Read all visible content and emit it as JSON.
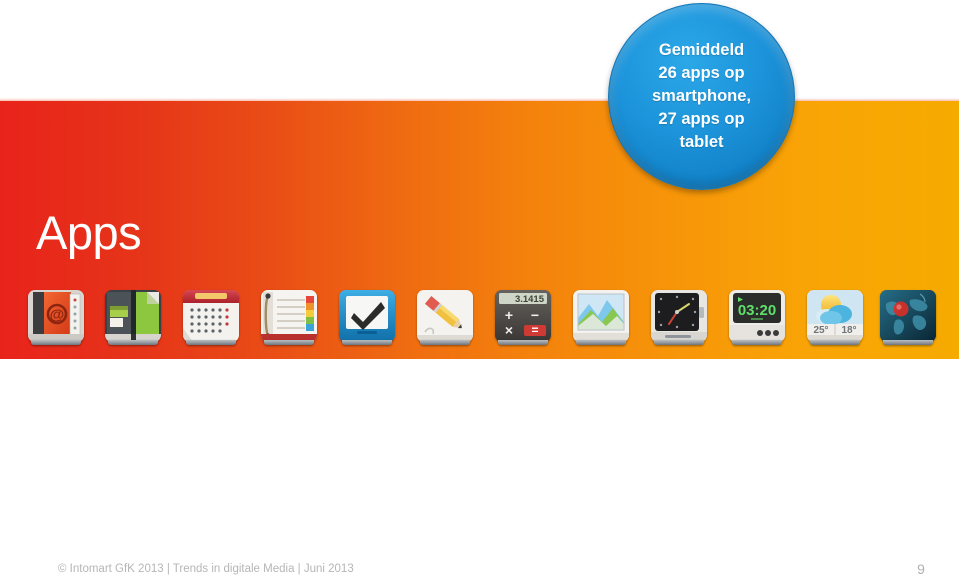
{
  "slide": {
    "title": "Apps",
    "background_color": "#ffffff",
    "band": {
      "gradient_start_color": "#e8231b",
      "gradient_end_color": "#f6ab00"
    }
  },
  "callout": {
    "shape": "circle",
    "fill_color": "#1c93da",
    "text_color": "#ffffff",
    "lines": [
      "Gemiddeld",
      "26 apps op",
      "smartphone,",
      "27 apps op",
      "tablet"
    ],
    "text": "Gemiddeld 26 apps op smartphone, 27 apps op tablet",
    "stats": {
      "smartphone_apps": 26,
      "tablet_apps": 27
    }
  },
  "app_icons": [
    {
      "name": "contacts-app-icon",
      "label": "Contacts",
      "glyph": "@"
    },
    {
      "name": "notebook-app-icon",
      "label": "Notebook",
      "glyph": ""
    },
    {
      "name": "calendar-app-icon",
      "label": "Calendar",
      "glyph": ""
    },
    {
      "name": "notepad-app-icon",
      "label": "Notepad",
      "glyph": ""
    },
    {
      "name": "tasks-app-icon",
      "label": "Tasks",
      "glyph": "✔"
    },
    {
      "name": "draw-app-icon",
      "label": "Draw",
      "glyph": ""
    },
    {
      "name": "calculator-app-icon",
      "label": "Calculator",
      "display": "3.1415"
    },
    {
      "name": "photos-app-icon",
      "label": "Photos",
      "glyph": ""
    },
    {
      "name": "watch-app-icon",
      "label": "Watch",
      "glyph": ""
    },
    {
      "name": "alarm-clock-app-icon",
      "label": "Alarm Clock",
      "display": "03:20"
    },
    {
      "name": "weather-app-icon",
      "label": "Weather",
      "high_temp": "25°",
      "low_temp": "18°"
    },
    {
      "name": "world-map-app-icon",
      "label": "World Map",
      "glyph": ""
    }
  ],
  "footer": {
    "copyright": "© Intomart GfK 2013 | Trends in digitale Media | Juni 2013",
    "page_number": "9"
  }
}
